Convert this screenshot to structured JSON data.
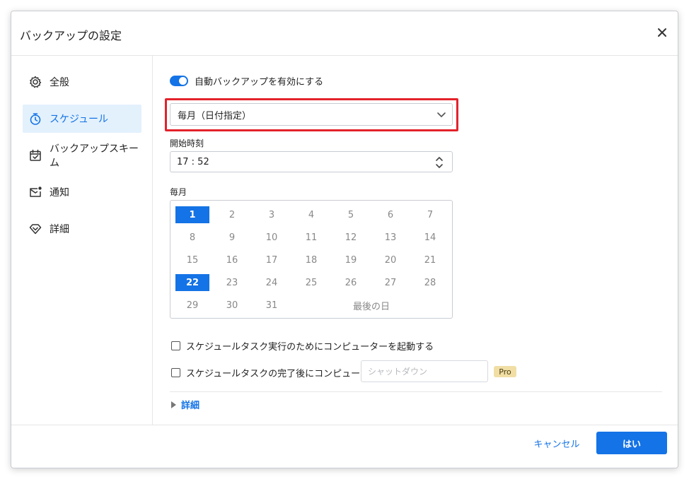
{
  "dialog": {
    "title": "バックアップの設定",
    "close_icon": "close-icon"
  },
  "sidebar": {
    "items": [
      {
        "label": "全般",
        "icon": "gear-icon"
      },
      {
        "label": "スケジュール",
        "icon": "stopwatch-icon"
      },
      {
        "label": "バックアップスキーム",
        "icon": "calendar-check-icon"
      },
      {
        "label": "通知",
        "icon": "mail-icon"
      },
      {
        "label": "詳細",
        "icon": "diamond-icon"
      }
    ],
    "active_index": 1
  },
  "schedule": {
    "auto_backup_label": "自動バックアップを有効にする",
    "auto_backup_enabled": true,
    "frequency_value": "毎月（日付指定）",
    "start_time_label": "開始時刻",
    "start_time_value": "17 : 52",
    "monthly_label": "毎月",
    "days": [
      "1",
      "2",
      "3",
      "4",
      "5",
      "6",
      "7",
      "8",
      "9",
      "10",
      "11",
      "12",
      "13",
      "14",
      "15",
      "16",
      "17",
      "18",
      "19",
      "20",
      "21",
      "22",
      "23",
      "24",
      "25",
      "26",
      "27",
      "28",
      "29",
      "30",
      "31"
    ],
    "selected_days": [
      "1",
      "22"
    ],
    "last_day_label": "最後の日",
    "wake_label": "スケジュールタスク実行のためにコンピューターを起動する",
    "after_label": "スケジュールタスクの完了後にコンピューターを",
    "after_placeholder": "シャットダウン",
    "pro_badge": "Pro",
    "details_label": "詳細"
  },
  "footer": {
    "cancel_label": "キャンセル",
    "ok_label": "はい"
  },
  "colors": {
    "accent": "#1473e6",
    "highlight_border": "#e3222b",
    "selected_nav_bg": "#e3f1fd"
  }
}
